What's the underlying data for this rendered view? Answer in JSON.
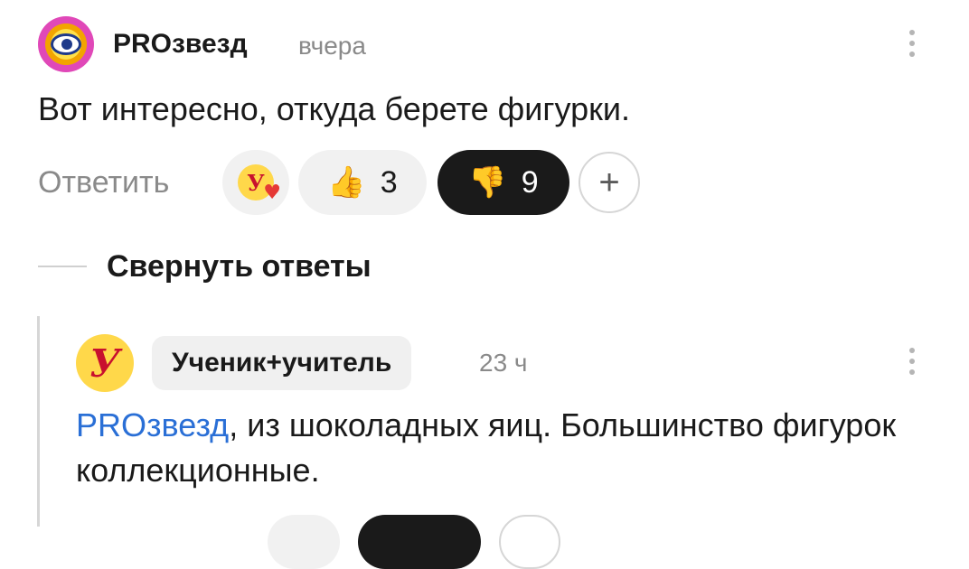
{
  "comment": {
    "author": "PROзвезд",
    "time": "вчера",
    "text": "Вот интересно, откуда берете фигурки.",
    "reply_label": "Ответить",
    "reactions": [
      {
        "icon": "teacher-heart-icon",
        "count": ""
      },
      {
        "icon": "thumbs-up-icon",
        "count": "3"
      },
      {
        "icon": "thumbs-down-icon",
        "count": "9"
      }
    ],
    "add_reaction": "+"
  },
  "thread": {
    "collapse_label": "Свернуть ответы"
  },
  "reply": {
    "author": "Ученик+учитель",
    "time": "23 ч",
    "mention": "PROзвезд",
    "text": ", из шоколадных яиц. Большинство фигурок коллекционные."
  },
  "colors": {
    "mention": "#2a6fd6",
    "dislike_bg": "#1a1a1a"
  }
}
